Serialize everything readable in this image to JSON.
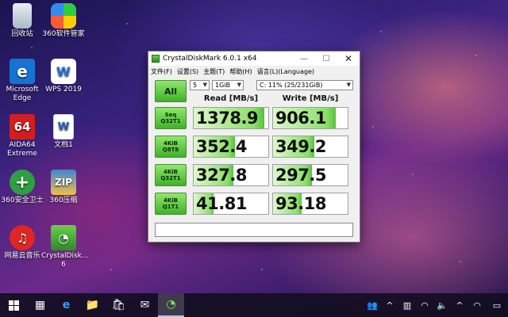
{
  "desktop": {
    "icons": [
      {
        "label": "回收站",
        "glyph": "🗑",
        "name": "recycle-bin-icon"
      },
      {
        "label": "360软件管家",
        "glyph": "",
        "name": "360-software-manager-icon"
      },
      {
        "label": "Microsoft Edge",
        "glyph": "e",
        "name": "edge-icon"
      },
      {
        "label": "WPS 2019",
        "glyph": "W",
        "name": "wps-icon"
      },
      {
        "label": "AIDA64 Extreme",
        "glyph": "64",
        "name": "aida64-icon"
      },
      {
        "label": "文档1",
        "glyph": "W",
        "name": "word-document-icon"
      },
      {
        "label": "360安全卫士",
        "glyph": "+",
        "name": "360-safe-icon"
      },
      {
        "label": "360压缩",
        "glyph": "ZIP",
        "name": "360-zip-icon"
      },
      {
        "label": "网易云音乐",
        "glyph": "♫",
        "name": "netease-music-icon"
      },
      {
        "label": "CrystalDisk... 6",
        "glyph": "◔",
        "name": "crystaldisk-shortcut-icon"
      }
    ]
  },
  "window": {
    "title": "CrystalDiskMark 6.0.1 x64",
    "controls": {
      "minimize": "—",
      "maximize": "☐",
      "close": "✕"
    },
    "menu": [
      "文件(F)",
      "设置(S)",
      "主题(T)",
      "帮助(H)",
      "语言(L)(Language)"
    ],
    "all_label": "All",
    "count_select": "5",
    "size_select": "1GiB",
    "drive_select": "C: 11% (25/231GiB)",
    "read_header": "Read [MB/s]",
    "write_header": "Write [MB/s]",
    "tests": [
      {
        "line1": "Seq",
        "line2": "Q32T1",
        "read": "1378.9",
        "write": "906.1",
        "read_fill": 0.95,
        "write_fill": 0.84
      },
      {
        "line1": "4KiB",
        "line2": "Q8T8",
        "read": "352.4",
        "write": "349.2",
        "read_fill": 0.55,
        "write_fill": 0.55
      },
      {
        "line1": "4KiB",
        "line2": "Q32T1",
        "read": "327.8",
        "write": "297.5",
        "read_fill": 0.53,
        "write_fill": 0.52
      },
      {
        "line1": "4KiB",
        "line2": "Q1T1",
        "read": "41.81",
        "write": "93.18",
        "read_fill": 0.27,
        "write_fill": 0.38
      }
    ],
    "comment": ""
  },
  "taskbar": {
    "items": [
      {
        "glyph": "▦",
        "name": "task-view-icon"
      },
      {
        "glyph": "e",
        "name": "edge-taskbar-icon"
      },
      {
        "glyph": "📁",
        "name": "file-explorer-icon"
      },
      {
        "glyph": "🛍",
        "name": "store-icon"
      },
      {
        "glyph": "✉",
        "name": "mail-icon"
      },
      {
        "glyph": "◔",
        "name": "crystaldiskmark-taskbar-icon"
      }
    ],
    "tray": [
      {
        "glyph": "👥",
        "name": "people-icon"
      },
      {
        "glyph": "^",
        "name": "show-hidden-icons-icon"
      },
      {
        "glyph": "▥",
        "name": "input-method-icon"
      },
      {
        "glyph": "◠",
        "name": "wifi-icon"
      },
      {
        "glyph": "🔈",
        "name": "volume-icon"
      },
      {
        "glyph": "^",
        "name": "tray-overflow-icon"
      },
      {
        "glyph": "◠",
        "name": "network-icon"
      },
      {
        "glyph": "▭",
        "name": "notifications-icon"
      }
    ]
  }
}
